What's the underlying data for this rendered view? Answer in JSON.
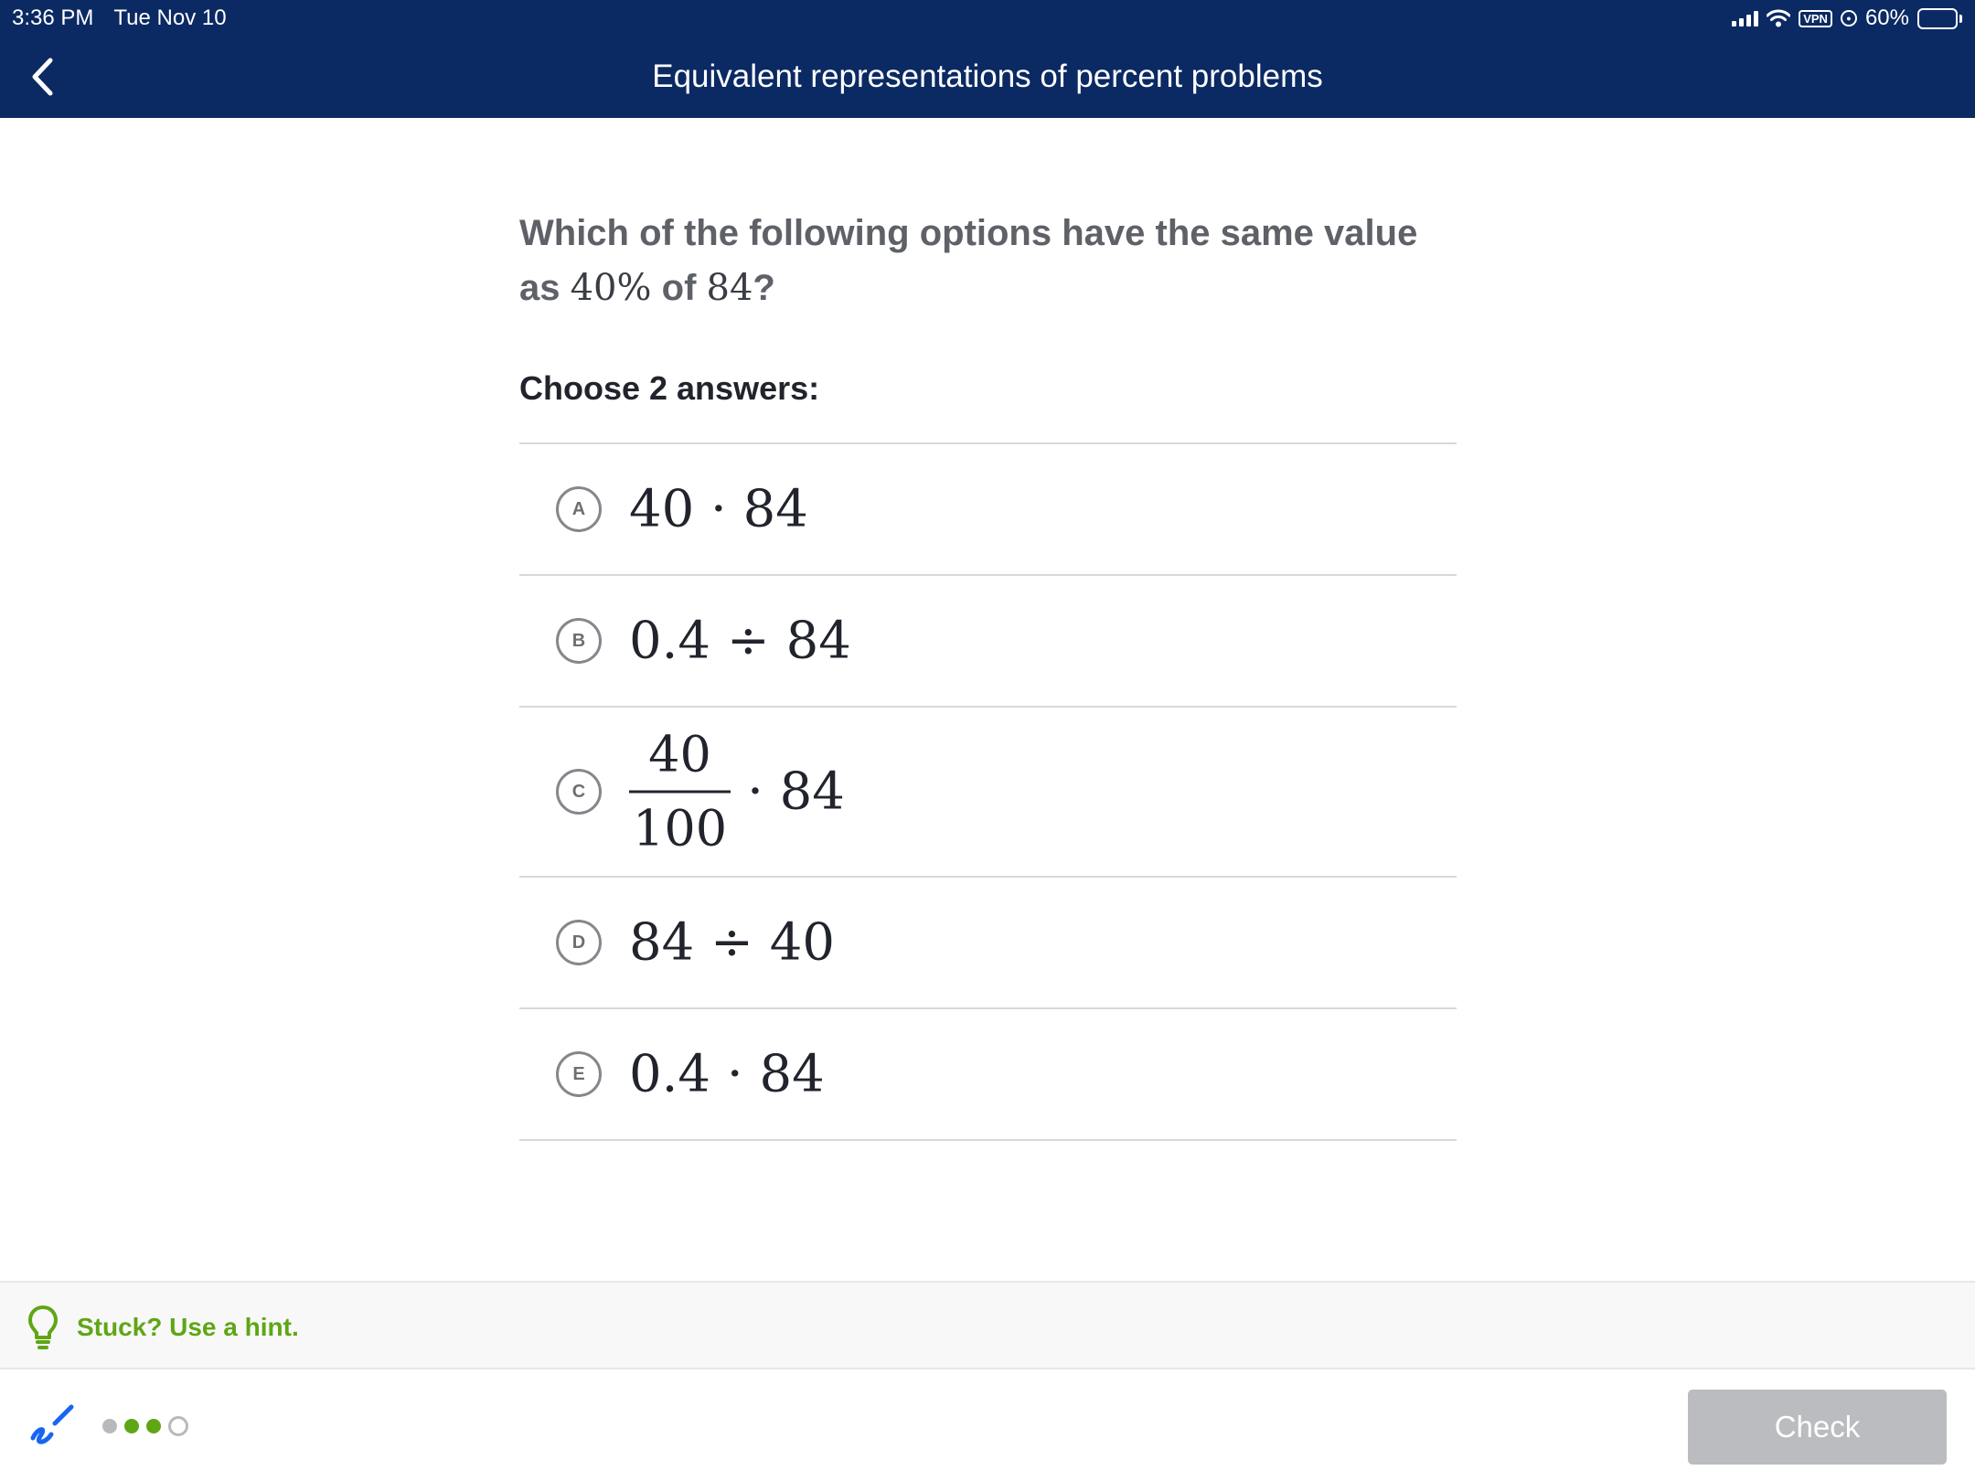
{
  "status_bar": {
    "time": "3:36 PM",
    "date": "Tue Nov 10",
    "vpn_label": "VPN",
    "battery_text": "60%",
    "battery_level": 0.6
  },
  "header": {
    "title": "Equivalent representations of percent problems",
    "background_color": "#0b2a63"
  },
  "question": {
    "text_prefix": "Which of the following options have the same value as ",
    "percent": "40%",
    "text_middle": " of ",
    "number": "84",
    "text_suffix": "?"
  },
  "instruction": "Choose 2 answers:",
  "choices": [
    {
      "letter": "A",
      "expression": "40 · 84"
    },
    {
      "letter": "B",
      "expression": "0.4 ÷ 84"
    },
    {
      "letter": "C",
      "numerator": "40",
      "denominator": "100",
      "after": "· 84"
    },
    {
      "letter": "D",
      "expression": "84 ÷ 40"
    },
    {
      "letter": "E",
      "expression": "0.4 · 84"
    }
  ],
  "hint": {
    "label": "Stuck? Use a hint.",
    "color": "#5fa615"
  },
  "progress": {
    "total": 4,
    "completed": 3,
    "current_index": 4
  },
  "check_button": {
    "label": "Check",
    "enabled": false
  }
}
